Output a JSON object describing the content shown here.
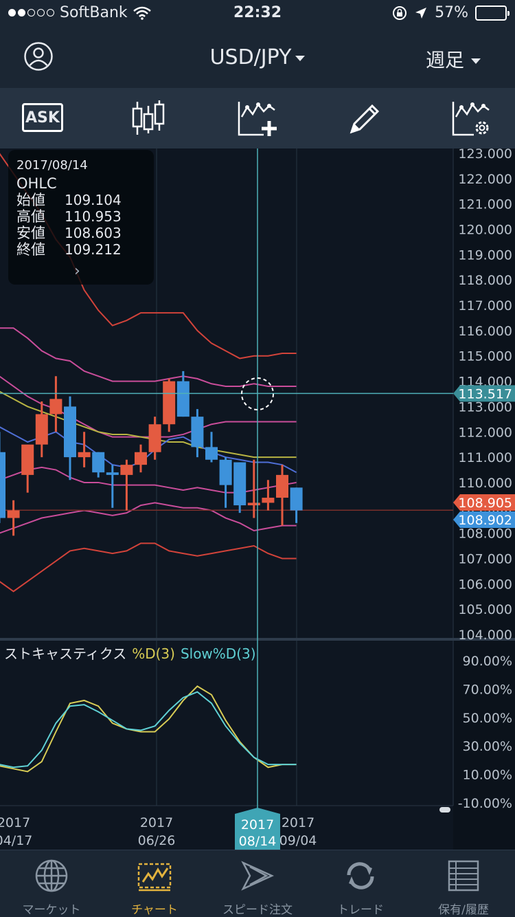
{
  "status_bar": {
    "carrier": "SoftBank",
    "time": "22:32",
    "battery": "57%",
    "battery_level": 0.57
  },
  "header": {
    "symbol": "USD/JPY",
    "period": "週足"
  },
  "toolbar": {
    "ask_label": "ASK"
  },
  "ohlc_popup": {
    "date": "2017/08/14",
    "heading": "OHLC",
    "rows": [
      {
        "label": "始値",
        "value": "109.104"
      },
      {
        "label": "高値",
        "value": "110.953"
      },
      {
        "label": "安値",
        "value": "108.603"
      },
      {
        "label": "終値",
        "value": "109.212"
      }
    ]
  },
  "chart_data": [
    {
      "type": "candlestick",
      "price_ticks": [
        "123.000",
        "122.000",
        "121.000",
        "120.000",
        "119.000",
        "118.000",
        "117.000",
        "116.000",
        "115.000",
        "114.000",
        "113.000",
        "112.000",
        "111.000",
        "110.000",
        "109.000",
        "108.000",
        "107.000",
        "106.000",
        "105.000",
        "104.000"
      ],
      "ylim": [
        103.96,
        123.03
      ],
      "crosshair_price": "113.517",
      "bid_price": "108.905",
      "ask_price": "108.902",
      "crosshair_date": [
        "2017",
        "08/14"
      ],
      "x_ticks": [
        {
          "year": "2017",
          "date": "04/17"
        },
        {
          "year": "2017",
          "date": "06/26"
        },
        {
          "year": "2017",
          "date": "09/04"
        }
      ],
      "candles": [
        {
          "o": 111.2,
          "h": 112.0,
          "l": 108.4,
          "c": 108.6
        },
        {
          "o": 108.6,
          "h": 109.3,
          "l": 107.9,
          "c": 108.9
        },
        {
          "o": 110.3,
          "h": 111.3,
          "l": 109.6,
          "c": 111.5
        },
        {
          "o": 111.5,
          "h": 113.2,
          "l": 111.0,
          "c": 112.7
        },
        {
          "o": 112.7,
          "h": 114.2,
          "l": 112.0,
          "c": 113.3
        },
        {
          "o": 113.0,
          "h": 113.4,
          "l": 110.1,
          "c": 111.0
        },
        {
          "o": 111.0,
          "h": 112.0,
          "l": 110.6,
          "c": 111.2
        },
        {
          "o": 111.2,
          "h": 111.2,
          "l": 110.2,
          "c": 110.4
        },
        {
          "o": 110.4,
          "h": 110.7,
          "l": 109.0,
          "c": 110.3
        },
        {
          "o": 110.3,
          "h": 110.9,
          "l": 108.9,
          "c": 110.7
        },
        {
          "o": 110.7,
          "h": 111.5,
          "l": 110.4,
          "c": 111.2
        },
        {
          "o": 111.2,
          "h": 112.6,
          "l": 110.9,
          "c": 112.3
        },
        {
          "o": 112.3,
          "h": 114.1,
          "l": 112.0,
          "c": 114.0
        },
        {
          "o": 114.0,
          "h": 114.4,
          "l": 112.6,
          "c": 112.6
        },
        {
          "o": 112.6,
          "h": 112.9,
          "l": 111.0,
          "c": 111.4
        },
        {
          "o": 111.4,
          "h": 112.0,
          "l": 110.8,
          "c": 110.9
        },
        {
          "o": 110.9,
          "h": 111.0,
          "l": 109.0,
          "c": 109.9
        },
        {
          "o": 110.8,
          "h": 110.8,
          "l": 108.8,
          "c": 109.1
        },
        {
          "o": 109.1,
          "h": 110.9,
          "l": 108.6,
          "c": 109.2
        },
        {
          "o": 109.2,
          "h": 110.1,
          "l": 108.9,
          "c": 109.4
        },
        {
          "o": 109.4,
          "h": 110.7,
          "l": 108.3,
          "c": 110.3
        },
        {
          "o": 109.8,
          "h": 109.8,
          "l": 108.4,
          "c": 108.9
        }
      ],
      "bollinger_upper2": [
        123.0,
        122.2,
        121.4,
        120.6,
        119.6,
        118.9,
        117.6,
        116.8,
        116.2,
        116.4,
        116.7,
        116.7,
        116.7,
        116.7,
        116.0,
        115.5,
        115.2,
        114.9,
        115.0,
        115.0,
        115.1,
        115.1
      ],
      "bollinger_upper1": [
        116.1,
        116.1,
        115.7,
        115.2,
        114.9,
        114.8,
        114.4,
        114.2,
        114.0,
        114.0,
        114.0,
        114.0,
        114.1,
        114.2,
        114.1,
        113.9,
        113.8,
        113.8,
        113.9,
        113.8,
        113.8,
        113.8
      ],
      "bollinger_middle": [
        114.2,
        113.8,
        113.4,
        113.1,
        112.9,
        112.6,
        112.3,
        112.0,
        111.8,
        111.8,
        111.8,
        111.8,
        111.8,
        111.9,
        112.1,
        112.3,
        112.4,
        112.4,
        112.4,
        112.4,
        112.4,
        112.4
      ],
      "sma_long": [
        113.6,
        113.3,
        113.0,
        112.8,
        112.6,
        112.4,
        112.2,
        112.0,
        111.9,
        111.9,
        111.8,
        111.7,
        111.6,
        111.6,
        111.4,
        111.3,
        111.2,
        111.1,
        111.0,
        111.0,
        111.0,
        111.0
      ],
      "sma_short": [
        112.2,
        111.9,
        111.6,
        111.8,
        112.0,
        111.6,
        111.5,
        111.1,
        110.7,
        110.6,
        110.8,
        111.3,
        111.7,
        111.8,
        111.5,
        111.2,
        111.0,
        110.9,
        110.8,
        110.8,
        110.7,
        110.4
      ],
      "bollinger_lower1": [
        110.1,
        110.3,
        110.5,
        110.6,
        110.5,
        110.2,
        110.0,
        110.0,
        109.9,
        109.9,
        109.9,
        109.9,
        109.8,
        109.7,
        109.8,
        109.7,
        109.6,
        109.6,
        109.7,
        109.8,
        109.9,
        110.0
      ],
      "bollinger_lower2": [
        108.0,
        108.2,
        108.4,
        108.6,
        108.7,
        108.8,
        108.9,
        108.8,
        108.7,
        108.8,
        109.1,
        109.2,
        109.1,
        109.0,
        109.0,
        108.9,
        108.6,
        108.4,
        108.1,
        108.2,
        108.3,
        108.3
      ],
      "bollinger_lower3": [
        106.1,
        105.7,
        106.1,
        106.5,
        106.9,
        107.3,
        107.4,
        107.3,
        107.2,
        107.3,
        107.6,
        107.6,
        107.3,
        107.2,
        107.1,
        107.2,
        107.3,
        107.4,
        107.5,
        107.2,
        107.0,
        107.0
      ]
    },
    {
      "type": "line",
      "title": "ストキャスティクス",
      "series": [
        {
          "name": "%D(3)",
          "color": "#d8cc55",
          "values": [
            16,
            14,
            12,
            19,
            40,
            60,
            62,
            58,
            46,
            42,
            40,
            40,
            49,
            62,
            72,
            66,
            48,
            33,
            22,
            15,
            17,
            17
          ]
        },
        {
          "name": "Slow%D(3)",
          "color": "#5fd0d4",
          "values": [
            17,
            15,
            16,
            27,
            46,
            58,
            59,
            54,
            48,
            42,
            41,
            44,
            55,
            64,
            68,
            60,
            44,
            32,
            22,
            17,
            17,
            17
          ]
        }
      ],
      "y_ticks": [
        "90.00%",
        "70.00%",
        "50.00%",
        "30.00%",
        "10.00%",
        "-10.00%"
      ],
      "ylim": [
        -10,
        90
      ]
    }
  ],
  "tabs": [
    {
      "label": "マーケット",
      "icon": "globe-icon"
    },
    {
      "label": "チャート",
      "icon": "chart-icon",
      "active": true
    },
    {
      "label": "スピード注文",
      "icon": "speed-order-icon"
    },
    {
      "label": "トレード",
      "icon": "trade-icon"
    },
    {
      "label": "保有/履歴",
      "icon": "history-icon"
    }
  ],
  "colors": {
    "bull": "#e45b41",
    "bear": "#3d92db",
    "crosshair": "#4fb0b8",
    "active_tab": "#e3b33e"
  }
}
